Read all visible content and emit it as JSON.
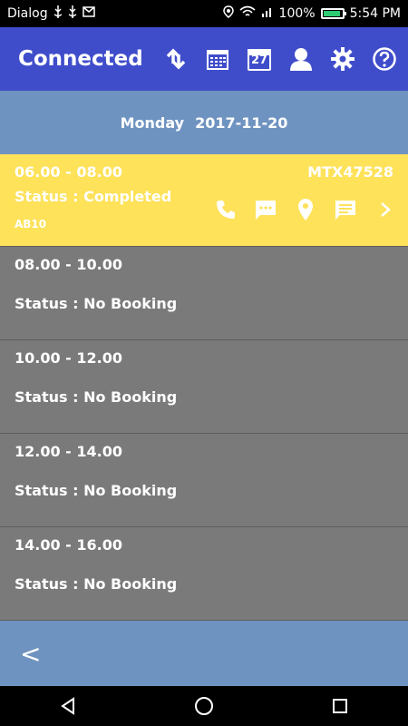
{
  "status_bar": {
    "carrier": "Dialog",
    "battery": "100%",
    "time": "5:54 PM"
  },
  "app_bar": {
    "title": "Connected",
    "calendar_day": "27",
    "icons": [
      "sync-icon",
      "calendar-grid-icon",
      "calendar-day-icon",
      "user-icon",
      "settings-icon",
      "help-icon"
    ]
  },
  "date_header": {
    "day": "Monday",
    "date": "2017-11-20"
  },
  "slots": [
    {
      "time": "06.00 - 08.00",
      "status": "Status : Completed",
      "code": "MTX47528",
      "sub": "AB10",
      "active": true
    },
    {
      "time": "08.00 - 10.00",
      "status": "Status : No Booking"
    },
    {
      "time": "10.00 - 12.00",
      "status": "Status : No Booking"
    },
    {
      "time": "12.00 - 14.00",
      "status": "Status : No Booking"
    },
    {
      "time": "14.00 - 16.00",
      "status": "Status : No Booking"
    }
  ],
  "bottom_bar": {
    "back_label": "<"
  },
  "colors": {
    "app_bar": "#3f4dcb",
    "date_bar": "#6f93c0",
    "active_row": "#fde25a",
    "row": "#7a7a7a"
  }
}
